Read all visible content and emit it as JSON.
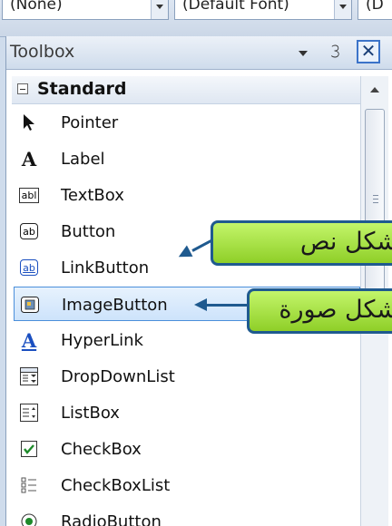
{
  "top_combos": [
    "(None)",
    "(Default Font)",
    "(D"
  ],
  "toolbox": {
    "title": "Toolbox",
    "category": "Standard",
    "items": [
      {
        "label": "Pointer",
        "icon": "pointer-icon"
      },
      {
        "label": "Label",
        "icon": "label-icon"
      },
      {
        "label": "TextBox",
        "icon": "textbox-icon"
      },
      {
        "label": "Button",
        "icon": "button-icon"
      },
      {
        "label": "LinkButton",
        "icon": "linkbutton-icon"
      },
      {
        "label": "ImageButton",
        "icon": "imagebutton-icon"
      },
      {
        "label": "HyperLink",
        "icon": "hyperlink-icon"
      },
      {
        "label": "DropDownList",
        "icon": "dropdownlist-icon"
      },
      {
        "label": "ListBox",
        "icon": "listbox-icon"
      },
      {
        "label": "CheckBox",
        "icon": "checkbox-icon"
      },
      {
        "label": "CheckBoxList",
        "icon": "checkboxlist-icon"
      },
      {
        "label": "RadioButton",
        "icon": "radiobutton-icon"
      }
    ],
    "selected_item": "ImageButton"
  },
  "callouts": {
    "text_shape": "شكل نص",
    "image_shape": "شكل صورة"
  },
  "colors": {
    "callout_fill": "#a6e03c",
    "callout_border": "#1f5a8f",
    "selection": "#cde3fb"
  }
}
